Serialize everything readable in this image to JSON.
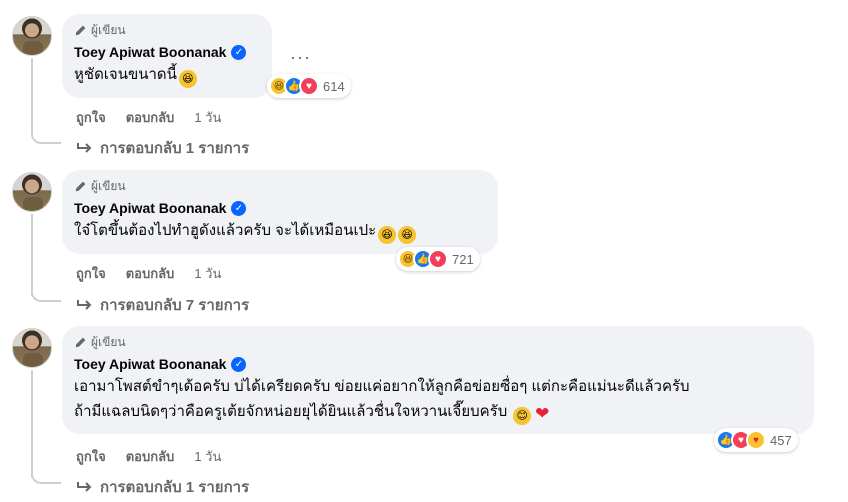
{
  "comments": [
    {
      "author_badge": "ผู้เขียน",
      "author_name": "Toey Apiwat Boonanak",
      "text": "หูชัดเจนขนาดนี้",
      "text_emojis": [
        "rofl-emoji"
      ],
      "reactions": [
        "haha",
        "like",
        "love"
      ],
      "reaction_count": "614",
      "actions": {
        "like": "ถูกใจ",
        "reply": "ตอบกลับ",
        "time": "1 วัน"
      },
      "replies_label": "การตอบกลับ 1 รายการ"
    },
    {
      "author_badge": "ผู้เขียน",
      "author_name": "Toey Apiwat Boonanak",
      "text": "ใจ๋โตขึ้นต้องไปทำฮูดังแล้วครับ จะได้เหมือนเปะ",
      "text_emojis": [
        "rofl-emoji",
        "rofl-emoji"
      ],
      "reactions": [
        "haha",
        "like",
        "love"
      ],
      "reaction_count": "721",
      "actions": {
        "like": "ถูกใจ",
        "reply": "ตอบกลับ",
        "time": "1 วัน"
      },
      "replies_label": "การตอบกลับ 7 รายการ"
    },
    {
      "author_badge": "ผู้เขียน",
      "author_name": "Toey Apiwat Boonanak",
      "text_line1": "เอามาโพสต์ขำๆเด้อครับ บ่ได้เครียดครับ ข่อยแค่อยากให้ลูกคือข่อยซื่อๆ แต่กะคือแม่นะดีแล้วครับ",
      "text_line2": "ถ้ามีแฉลบนิดๆว่าคือครูเต้ยจักหน่อยยุได้ยินแล้วชื่นใจหวานเจี๊ยบครับ",
      "text_emojis": [
        "smile-emoji",
        "red-heart-emoji"
      ],
      "reactions": [
        "like",
        "love",
        "care"
      ],
      "reaction_count": "457",
      "actions": {
        "like": "ถูกใจ",
        "reply": "ตอบกลับ",
        "time": "1 วัน"
      },
      "replies_label": "การตอบกลับ 1 รายการ"
    }
  ],
  "colors": {
    "bubble": "#f0f2f5",
    "meta_text": "#65676b",
    "verified": "#0866ff",
    "like": "#1877f2",
    "love": "#f33e58",
    "haha": "#f7c42f"
  }
}
